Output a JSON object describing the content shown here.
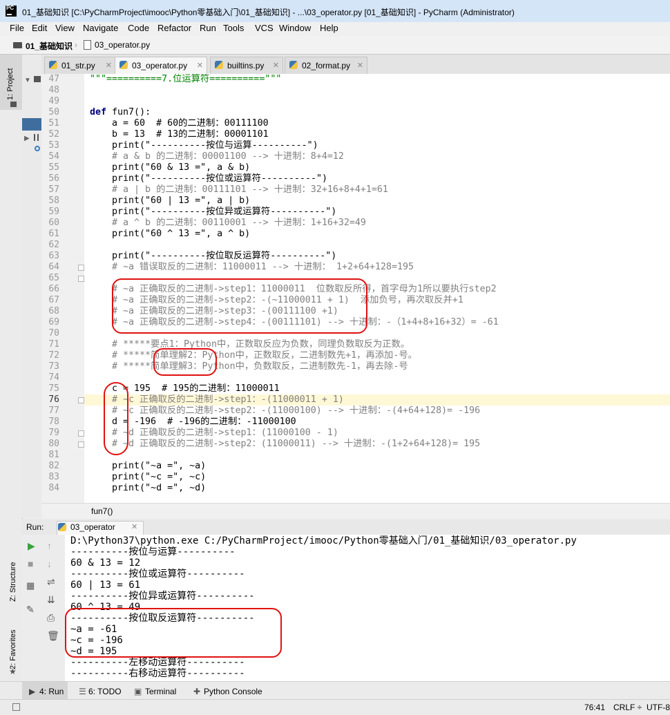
{
  "window": {
    "title": "01_基础知识 [C:\\PyCharmProject\\imooc\\Python零基础入门\\01_基础知识] - ...\\03_operator.py [01_基础知识] - PyCharm (Administrator)",
    "logo": "PC"
  },
  "menu": [
    "File",
    "Edit",
    "View",
    "Navigate",
    "Code",
    "Refactor",
    "Run",
    "Tools",
    "VCS",
    "Window",
    "Help"
  ],
  "breadcrumb": {
    "folder": "01_基础知识",
    "file": "03_operator.py"
  },
  "left_tools": {
    "project": "1: Project",
    "structure": "Z: Structure",
    "favorites": "2: Favorites"
  },
  "tabs": [
    {
      "label": "01_str.py",
      "active": false
    },
    {
      "label": "03_operator.py",
      "active": true
    },
    {
      "label": "builtins.py",
      "active": false
    },
    {
      "label": "02_format.py",
      "active": false
    }
  ],
  "line_numbers": [
    "47",
    "48",
    "49",
    "50",
    "51",
    "52",
    "53",
    "54",
    "55",
    "56",
    "57",
    "58",
    "59",
    "60",
    "61",
    "62",
    "63",
    "64",
    "65",
    "66",
    "67",
    "68",
    "69",
    "70",
    "71",
    "72",
    "73",
    "74",
    "75",
    "76",
    "77",
    "78",
    "79",
    "80",
    "81",
    "82",
    "83",
    "84"
  ],
  "code_lines": {
    "l47": "\"\"\"==========7.位运算符==========\"\"\"",
    "l50_kw": "def",
    "l50_rest": " fun7():",
    "l51": "    a = 60  # 60的二进制：00111100",
    "l52": "    b = 13  # 13的二进制：00001101",
    "l53": "    print(\"----------按位与运算----------\")",
    "l54": "    # a & b 的二进制：00001100 --> 十进制：8+4=12",
    "l55": "    print(\"60 & 13 =\", a & b)",
    "l56": "    print(\"----------按位或运算符----------\")",
    "l57": "    # a | b 的二进制：00111101 --> 十进制：32+16+8+4+1=61",
    "l58": "    print(\"60 | 13 =\", a | b)",
    "l59": "    print(\"----------按位异或运算符----------\")",
    "l60": "    # a ^ b 的二进制：00110001 --> 十进制：1+16+32=49",
    "l61": "    print(\"60 ^ 13 =\", a ^ b)",
    "l63": "    print(\"----------按位取反运算符----------\")",
    "l64": "    # ~a 错误取反的二进制：11000011 --> 十进制： 1+2+64+128=195",
    "l66": "    # ~a 正确取反的二进制->step1：11000011  位数取反所得，首字母为1所以要执行step2",
    "l67": "    # ~a 正确取反的二进制->step2：-(~11000011 + 1)  添加负号，再次取反并+1",
    "l68": "    # ~a 正确取反的二进制->step3：-(00111100 +1)",
    "l69": "    # ~a 正确取反的二进制->step4：-(00111101) --> 十进制：-（1+4+8+16+32）= -61",
    "l71": "    # *****要点1：Python中，正数取反应为负数，同理负数取反为正数。",
    "l72": "    # *****简单理解2：Python中，正数取反，二进制数先+1，再添加-号。",
    "l73": "    # *****简单理解3：Python中，负数取反，二进制数先-1，再去除-号",
    "l75": "    c = 195  # 195的二进制：11000011",
    "l76": "    # ~c 正确取反的二进制->step1：-(11000011 + 1)",
    "l77": "    # ~c 正确取反的二进制->step2：-(11000100) --> 十进制：-(4+64+128)= -196",
    "l78": "    d = -196  # -196的二进制：-11000100",
    "l79": "    # ~d 正确取反的二进制->step1：(11000100 - 1)",
    "l80": "    # ~d 正确取反的二进制->step2：(11000011) --> 十进制：-(1+2+64+128)= 195",
    "l82": "    print(\"~a =\", ~a)",
    "l83": "    print(\"~c =\", ~c)",
    "l84": "    print(\"~d =\", ~d)"
  },
  "editor_breadcrumb": "fun7()",
  "run": {
    "label": "Run:",
    "config": "03_operator",
    "output": [
      "D:\\Python37\\python.exe C:/PyCharmProject/imooc/Python零基础入门/01_基础知识/03_operator.py",
      "----------按位与运算----------",
      "60 & 13 = 12",
      "----------按位或运算符----------",
      "60 | 13 = 61",
      "----------按位异或运算符----------",
      "60 ^ 13 = 49",
      "----------按位取反运算符----------",
      "~a = -61",
      "~c = -196",
      "~d = 195",
      "----------左移动运算符----------",
      "----------右移动运算符----------"
    ]
  },
  "bottom_tabs": [
    "4: Run",
    "6: TODO",
    "Terminal",
    "Python Console"
  ],
  "status": {
    "position": "76:41",
    "line_sep": "CRLF ÷",
    "encoding": "UTF-8"
  },
  "colors": {
    "keyword": "#000080",
    "string": "#008000",
    "number": "#0000ff",
    "comment": "#808080",
    "annotation_red": "#e01010"
  }
}
